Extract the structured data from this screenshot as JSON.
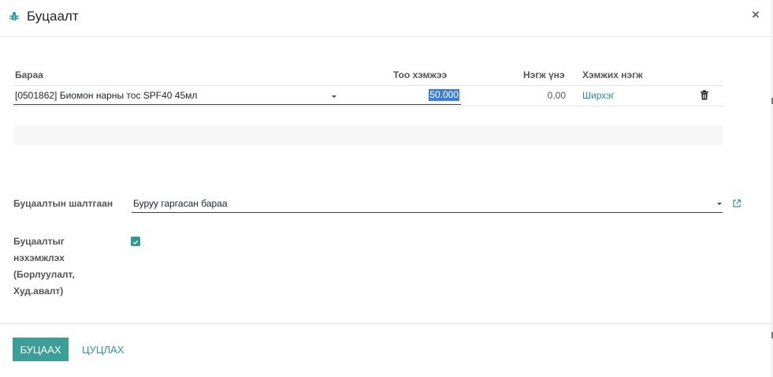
{
  "dialog": {
    "title": "Буцаалт",
    "close_label": "×"
  },
  "table": {
    "headers": {
      "product": "Бараа",
      "quantity": "Тоо хэмжээ",
      "unit_price": "Нэгж үнэ",
      "uom": "Хэмжих нэгж"
    },
    "rows": [
      {
        "product": "[0501862] Биомон нарны тос SPF40 45мл",
        "quantity": "50.000",
        "unit_price": "0.00",
        "uom": "Ширхэг"
      }
    ]
  },
  "form": {
    "reason_label": "Буцаалтын шалтгаан",
    "reason_value": "Буруу гаргасан бараа",
    "refund_label": "Буцаалтыг нэхэмжлэх (Борлуулалт, Худ.авалт)",
    "refund_checked": true
  },
  "footer": {
    "primary_button": "БУЦААХ",
    "cancel_button": "ЦУЦЛАХ"
  },
  "colors": {
    "accent": "#2a9a93",
    "primary_button": "#3b9e97",
    "selection": "#3d7fd6"
  }
}
